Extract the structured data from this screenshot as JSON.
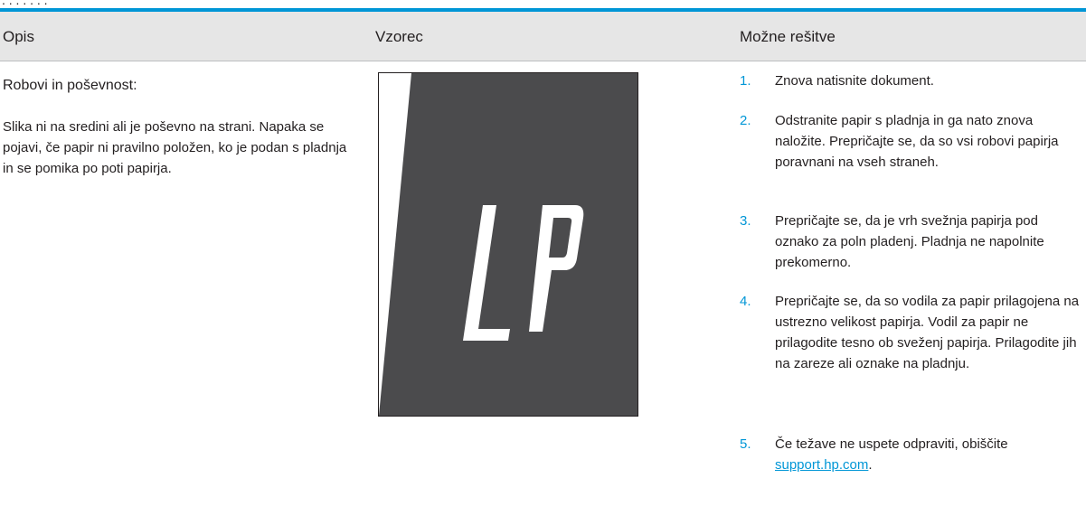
{
  "header": {
    "col_description": "Opis",
    "col_sample": "Vzorec",
    "col_solutions": "Možne rešitve"
  },
  "problem": {
    "title": "Robovi in poševnost:",
    "description": "Slika ni na sredini ali je poševno na strani. Napaka se pojavi, če papir ni pravilno položen, ko je podan s pladnja in se pomika po poti papirja."
  },
  "sample": {
    "letters": "LP",
    "page_color": "#4b4b4d",
    "letter_color": "#ffffff"
  },
  "solutions": [
    {
      "number": "1.",
      "text": "Znova natisnite dokument."
    },
    {
      "number": "2.",
      "text": "Odstranite papir s pladnja in ga nato znova naložite. Prepričajte se, da so vsi robovi papirja poravnani na vseh straneh."
    },
    {
      "number": "3.",
      "text": "Prepričajte se, da je vrh svežnja papirja pod oznako za poln pladenj. Pladnja ne napolnite prekomerno."
    },
    {
      "number": "4.",
      "text": "Prepričajte se, da so vodila za papir prilagojena na ustrezno velikost papirja. Vodil za papir ne prilagodite tesno ob sveženj papirja. Prilagodite jih na zareze ali oznake na pladnju."
    },
    {
      "number": "5.",
      "text": "Če težave ne uspete odpraviti, obiščite ",
      "link": "support.hp.com",
      "suffix": "."
    }
  ],
  "colors": {
    "accent": "#0096d6",
    "header_bg": "#e6e6e6",
    "text": "#231f20"
  }
}
